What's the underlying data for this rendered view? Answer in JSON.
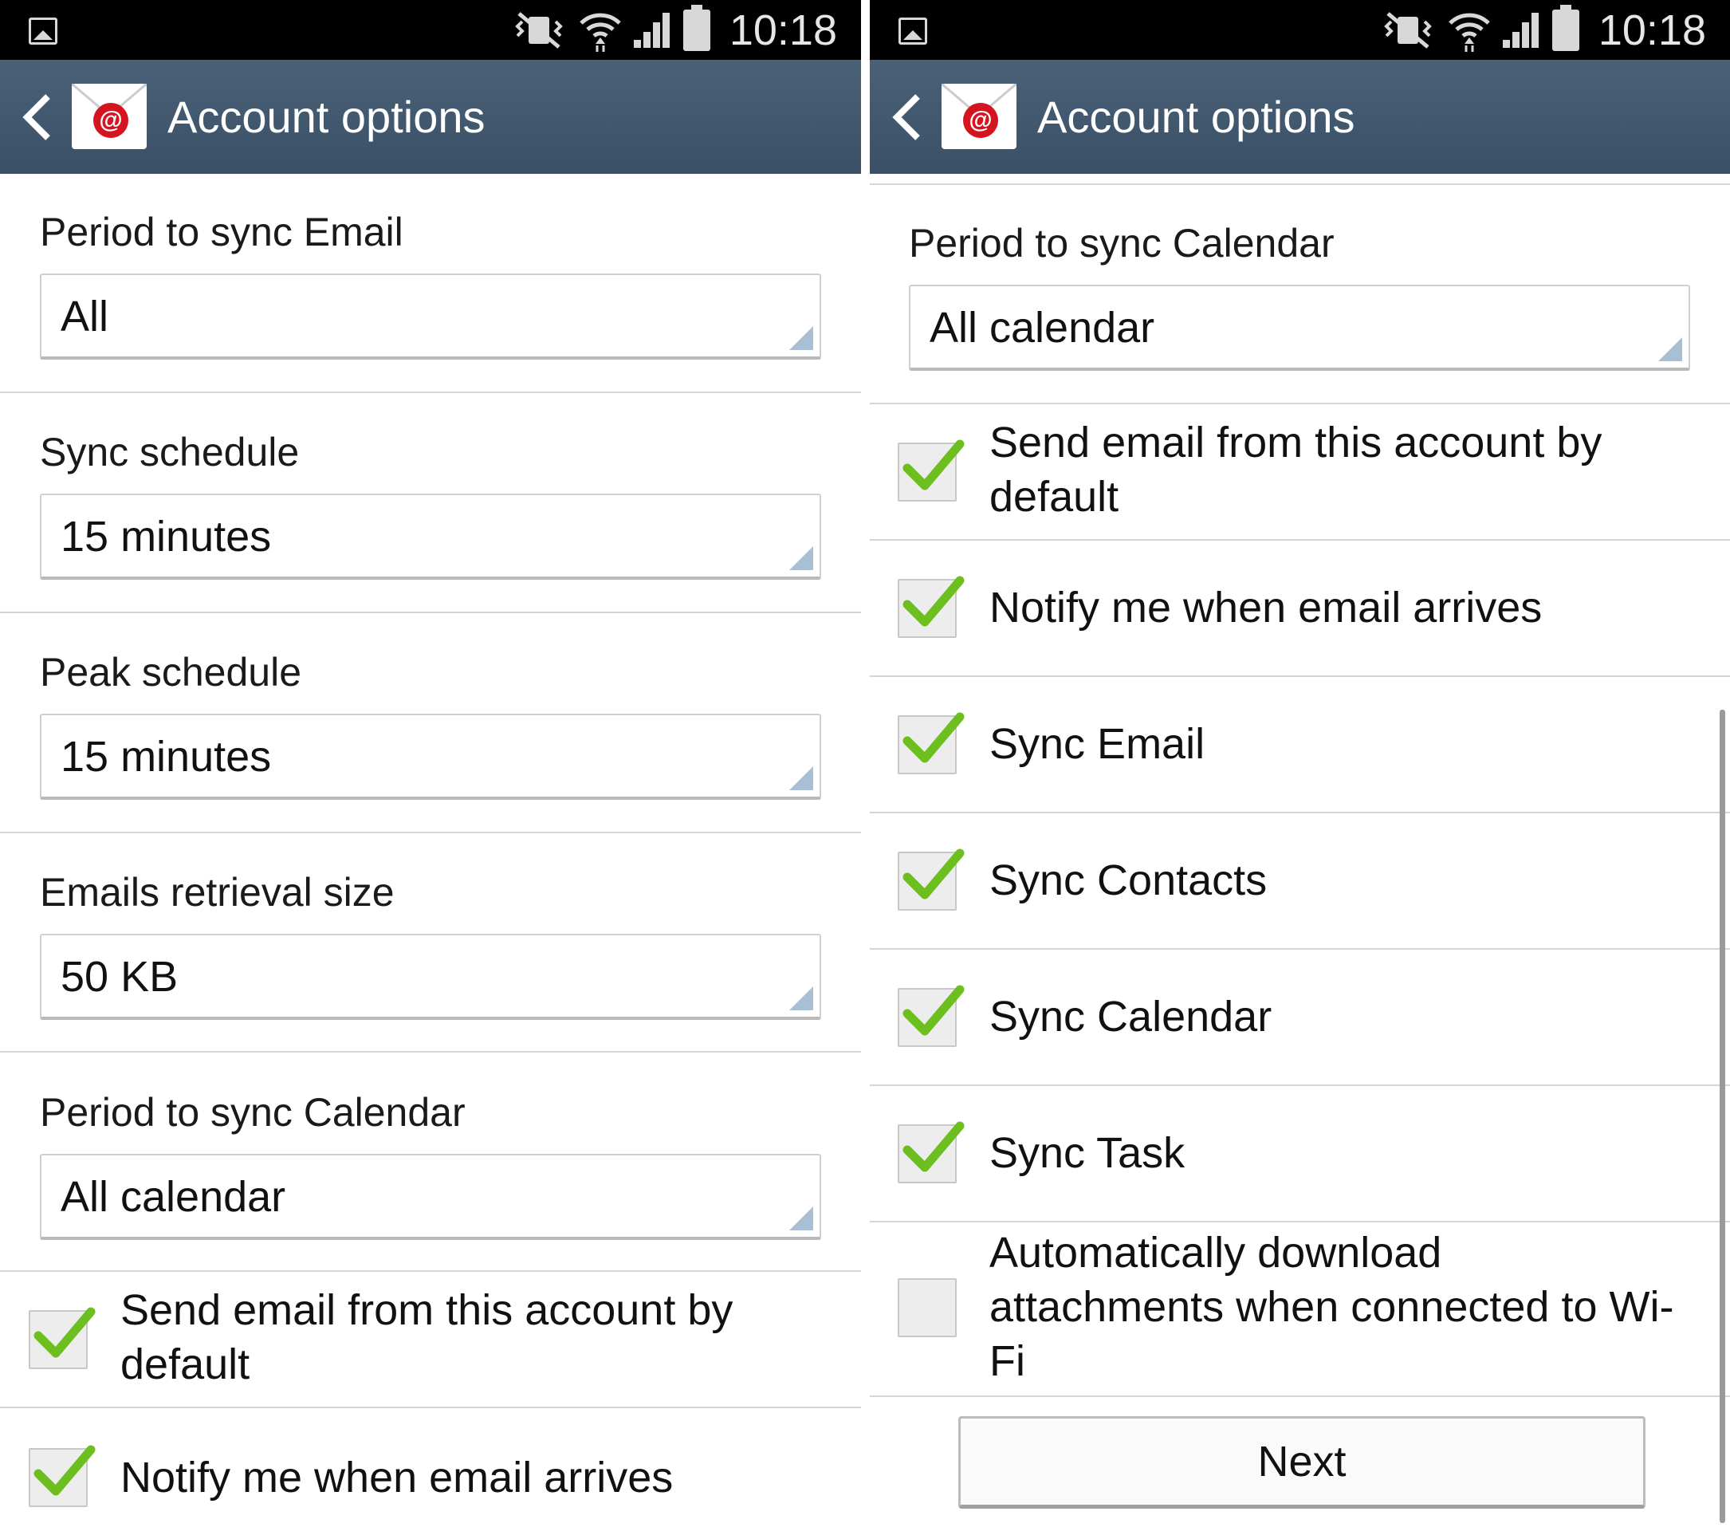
{
  "status_bar": {
    "time": "10:18"
  },
  "header": {
    "title": "Account options"
  },
  "left": {
    "dropdowns": [
      {
        "label": "Period to sync Email",
        "value": "All"
      },
      {
        "label": "Sync schedule",
        "value": "15 minutes"
      },
      {
        "label": "Peak schedule",
        "value": "15 minutes"
      },
      {
        "label": "Emails retrieval size",
        "value": "50 KB"
      },
      {
        "label": "Period to sync Calendar",
        "value": "All calendar"
      }
    ],
    "checkboxes": [
      {
        "label_line1": "Send email from this account by",
        "label_line2": "default",
        "checked": true
      },
      {
        "label_line1": "Notify me when email arrives",
        "checked": true
      }
    ]
  },
  "right": {
    "dropdowns": [
      {
        "label": "Period to sync Calendar",
        "value": "All calendar"
      }
    ],
    "checkboxes": [
      {
        "label_line1": "Send email from this account by",
        "label_line2": "default",
        "checked": true
      },
      {
        "label_line1": "Notify me when email arrives",
        "checked": true
      },
      {
        "label_line1": "Sync Email",
        "checked": true
      },
      {
        "label_line1": "Sync Contacts",
        "checked": true
      },
      {
        "label_line1": "Sync Calendar",
        "checked": true
      },
      {
        "label_line1": "Sync Task",
        "checked": true
      },
      {
        "label_line1": "Automatically download",
        "label_line2": "attachments when connected to Wi-",
        "label_line3": "Fi",
        "checked": false
      }
    ],
    "next_label": "Next"
  },
  "colors": {
    "header_bg": "#3e5469",
    "check_green": "#6cbf1f",
    "spinner_triangle": "#a9bfd3"
  }
}
